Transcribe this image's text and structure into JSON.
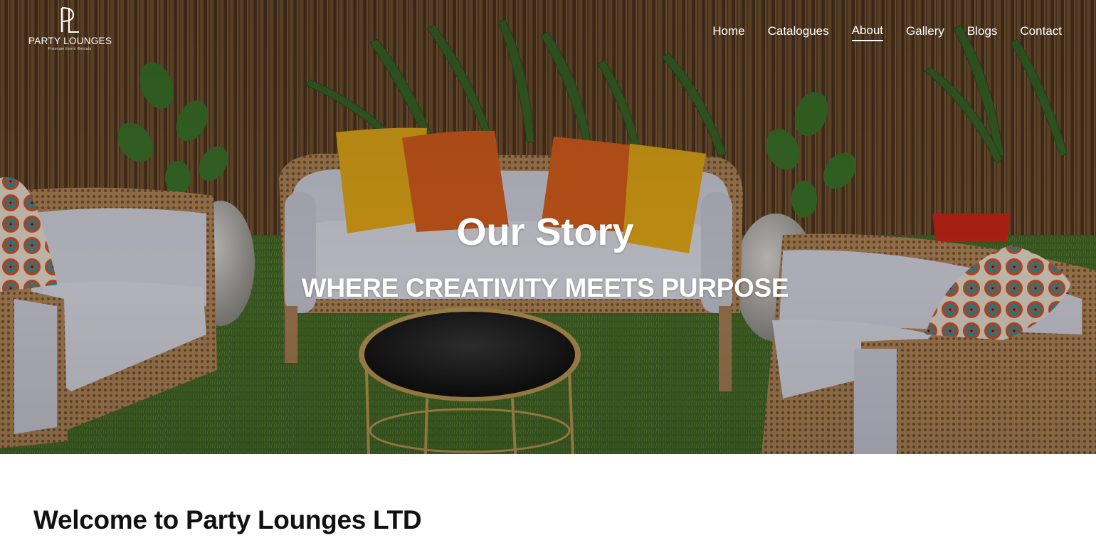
{
  "brand": {
    "monogram": "PL",
    "name": "PARTY LOUNGES",
    "tagline": "Premium Event Rentals"
  },
  "nav": {
    "items": [
      {
        "label": "Home",
        "active": false
      },
      {
        "label": "Catalogues",
        "active": false
      },
      {
        "label": "About",
        "active": true
      },
      {
        "label": "Gallery",
        "active": false
      },
      {
        "label": "Blogs",
        "active": false
      },
      {
        "label": "Contact",
        "active": false
      }
    ]
  },
  "hero": {
    "title": "Our Story",
    "subtitle": "WHERE CREATIVITY MEETS PURPOSE",
    "image": "outdoor lounge setup with rattan sofas, white cushions, yellow and orange pillows, round glass coffee table, potted palms, bamboo fence and artificial grass"
  },
  "content": {
    "heading": "Welcome to Party Lounges LTD"
  },
  "colors": {
    "text_on_hero": "#ffffff",
    "heading": "#111111",
    "background": "#ffffff"
  }
}
